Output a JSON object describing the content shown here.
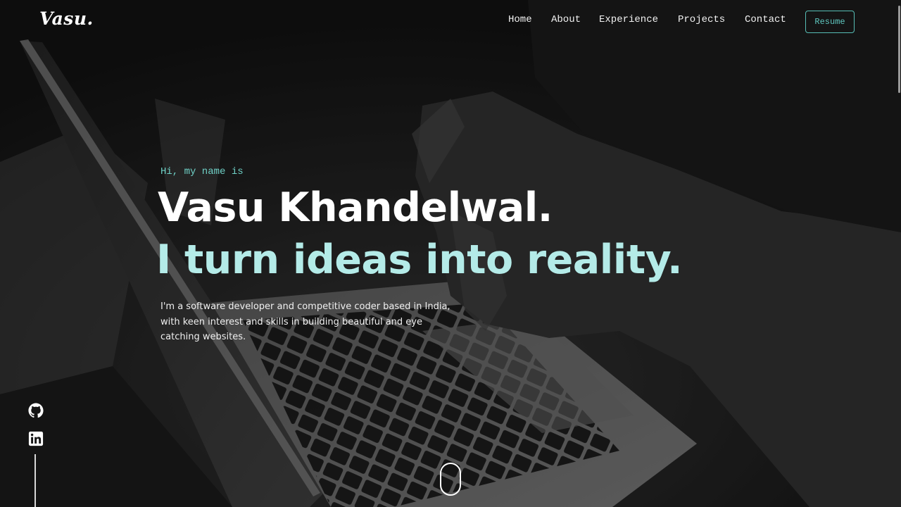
{
  "brand": {
    "logo_text": "Vasu."
  },
  "nav": {
    "items": [
      {
        "label": "Home"
      },
      {
        "label": "About"
      },
      {
        "label": "Experience"
      },
      {
        "label": "Projects"
      },
      {
        "label": "Contact"
      }
    ],
    "resume_label": "Resume"
  },
  "hero": {
    "greeting": "Hi, my name is",
    "name": "Vasu Khandelwal.",
    "tagline": "I turn ideas into reality.",
    "intro": "I'm a software developer and competitive coder based in India, with keen interest and skills in building beautiful and eye catching websites."
  },
  "social": {
    "icons": [
      "github-icon",
      "linkedin-icon"
    ]
  },
  "colors": {
    "accent": "#64cbc2",
    "tagline": "#b4ebe8",
    "background": "#161616"
  }
}
